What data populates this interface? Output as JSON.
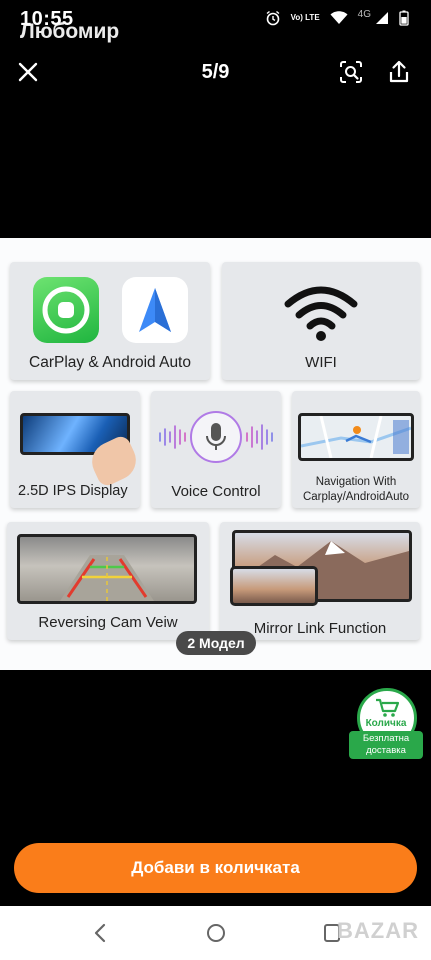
{
  "status": {
    "time": "10:55",
    "user": "Любомир",
    "network": "4G",
    "volte": "Vo) LTE"
  },
  "viewer": {
    "counter": "5/9"
  },
  "features": [
    {
      "label": "CarPlay & Android Auto"
    },
    {
      "label": "WIFI"
    },
    {
      "label": "2.5D IPS Display"
    },
    {
      "label": "Voice Control"
    },
    {
      "label_line1": "Navigation With",
      "label_line2": "Carplay/AndroidAuto"
    },
    {
      "label": "Reversing Cam Veiw"
    },
    {
      "label": "Mirror Link Function"
    }
  ],
  "model_pill": "2 Модел",
  "cart": {
    "label": "Количка",
    "free_line1": "Безплатна",
    "free_line2": "доставка"
  },
  "add_to_cart": "Добави в количката",
  "watermark": "BAZAR",
  "colors": {
    "accent": "#fa7d1a",
    "green": "#2aa84a",
    "carplay_green": "#2fc24b",
    "android_blue": "#3d8af7"
  },
  "icons": [
    "close-icon",
    "lens-icon",
    "share-icon",
    "back-icon",
    "home-icon",
    "recents-icon",
    "cart-icon",
    "wifi-icon",
    "microphone-icon"
  ]
}
